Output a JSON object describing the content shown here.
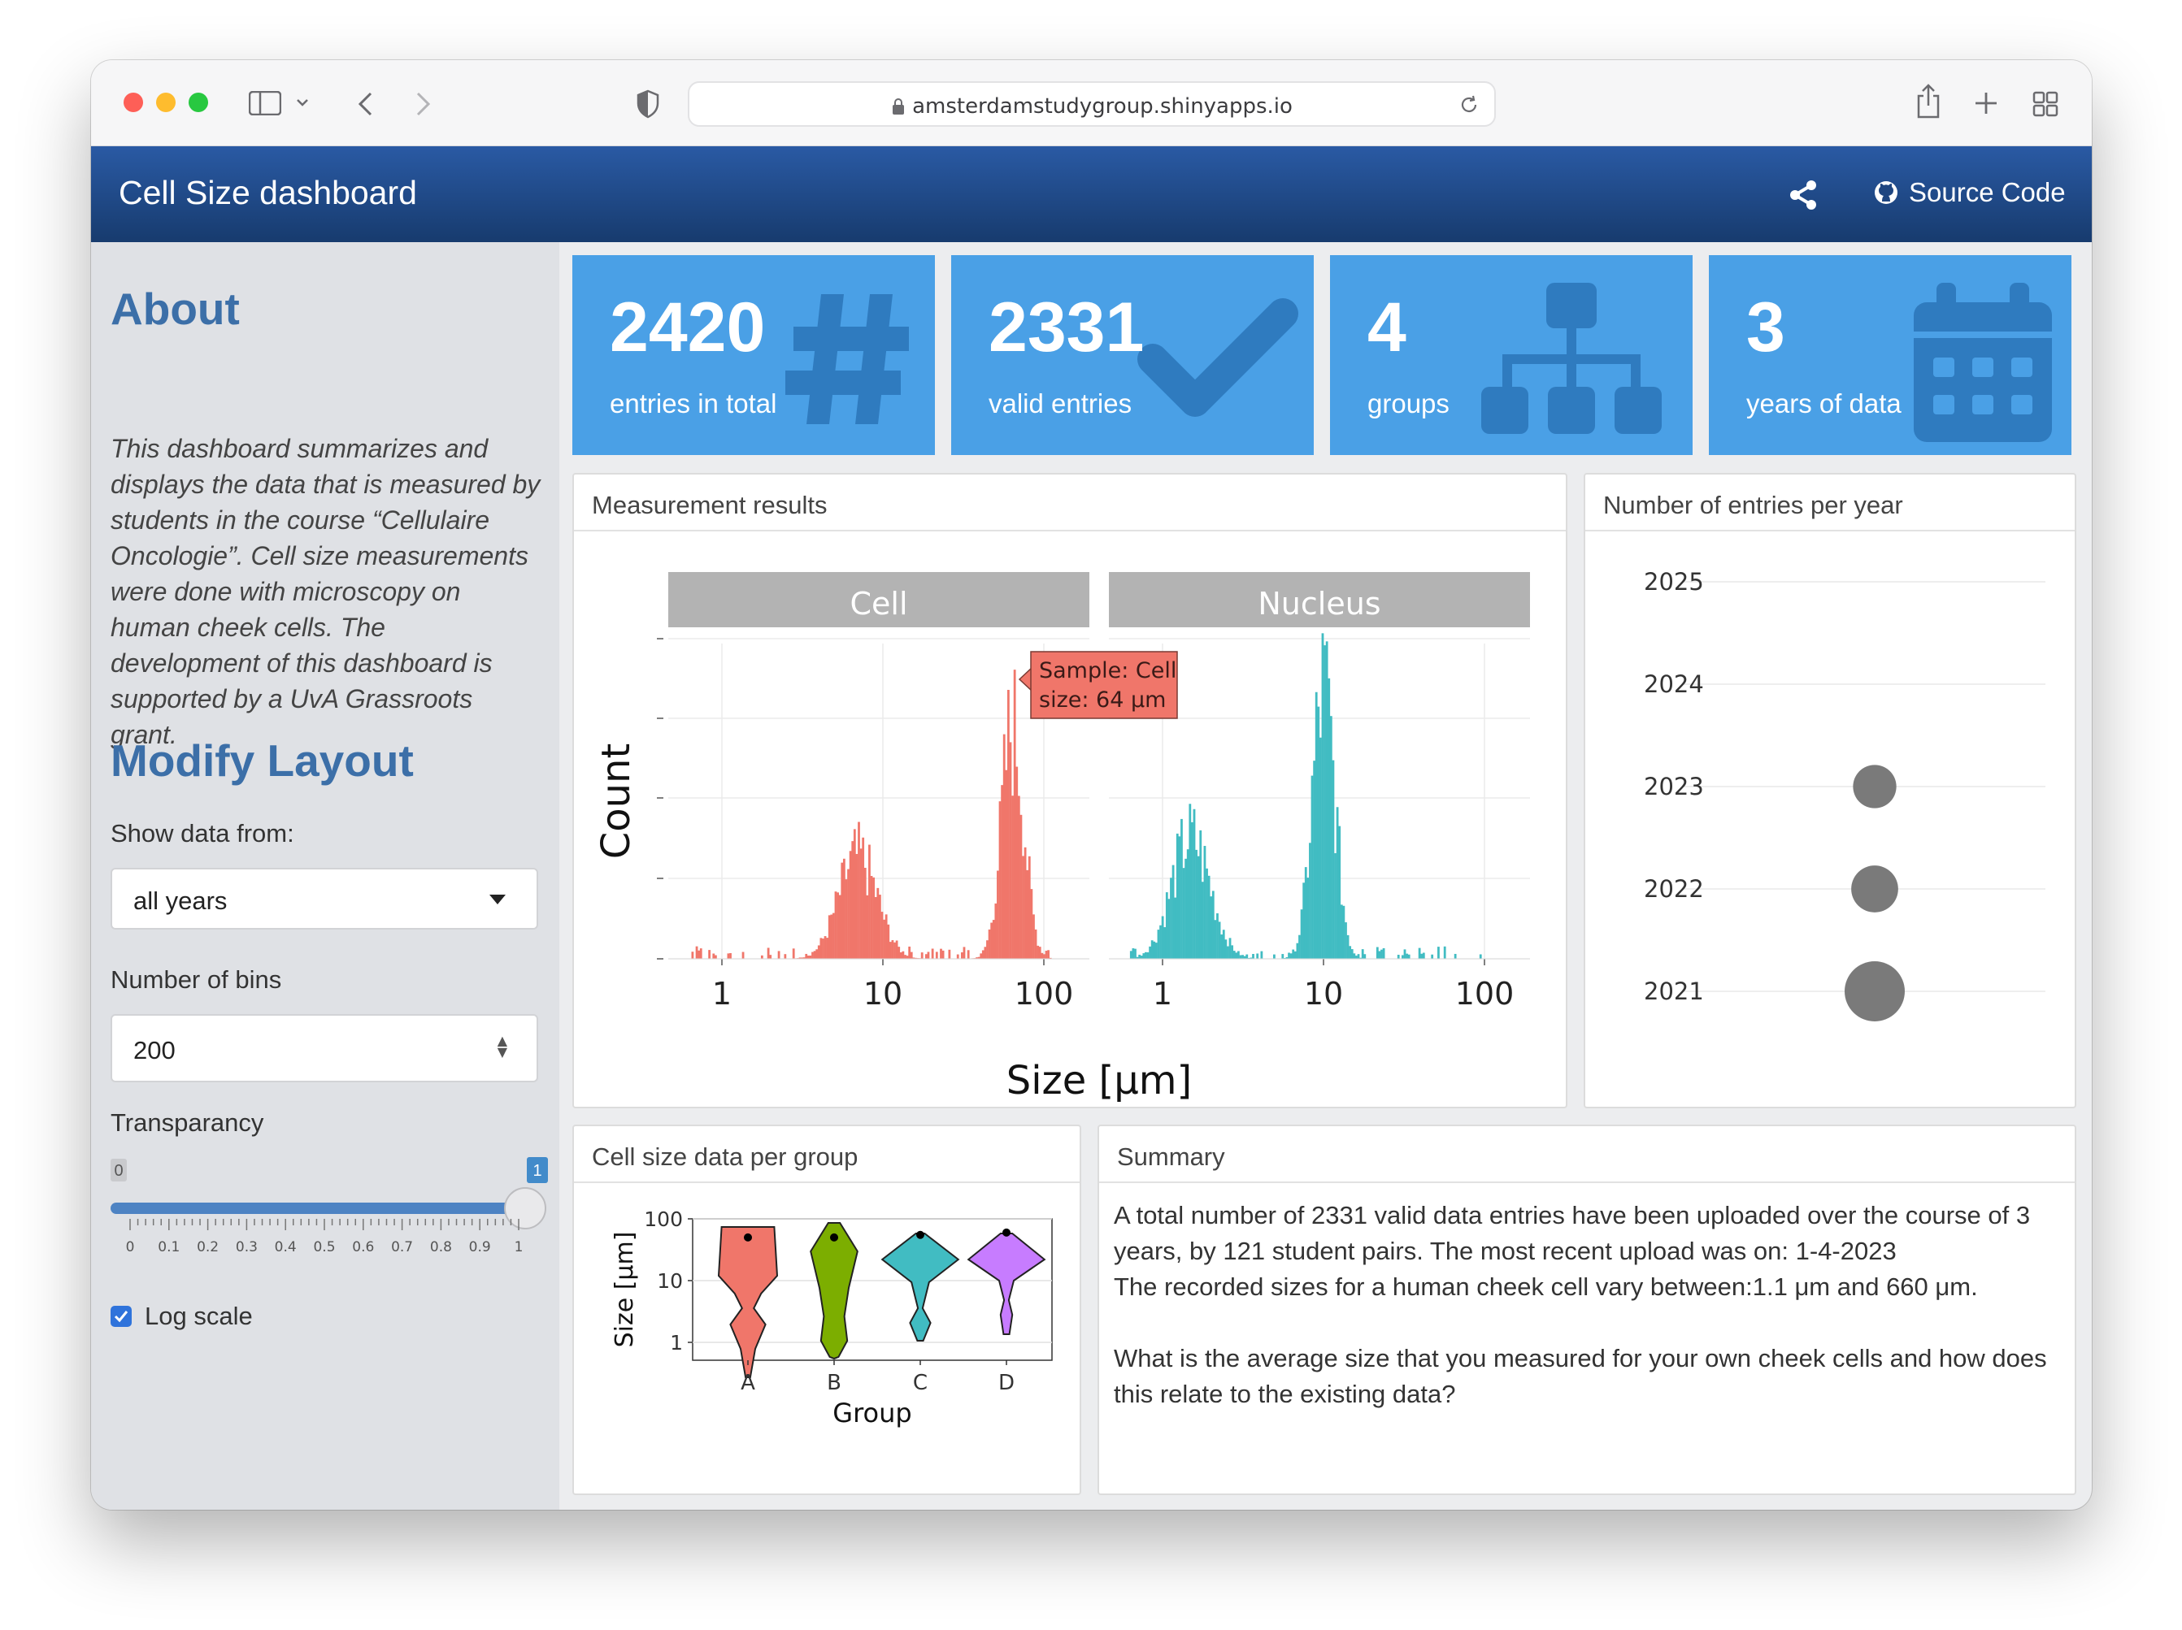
{
  "browser": {
    "url": "amsterdamstudygroup.shinyapps.io"
  },
  "navbar": {
    "title": "Cell Size dashboard",
    "source_code": "Source Code"
  },
  "sidebar": {
    "about_heading": "About",
    "about_text": "This dashboard summarizes and displays the data that is measured by students in the course “Cellulaire Oncologie”. Cell size measurements were done with microscopy on human cheek cells. The development of this dashboard is supported by a UvA Grassroots grant.",
    "layout_heading": "Modify Layout",
    "show_data_label": "Show data from:",
    "show_data_value": "all years",
    "bins_label": "Number of bins",
    "bins_value": "200",
    "transparancy_label": "Transparancy",
    "slider": {
      "min": "0",
      "max": "1",
      "value": "1",
      "ticks": [
        "0",
        "0.1",
        "0.2",
        "0.3",
        "0.4",
        "0.5",
        "0.6",
        "0.7",
        "0.8",
        "0.9",
        "1"
      ]
    },
    "log_scale_label": "Log scale",
    "log_scale_checked": true
  },
  "value_boxes": [
    {
      "value": "2420",
      "caption": "entries in total",
      "icon": "hashtag-icon"
    },
    {
      "value": "2331",
      "caption": "valid entries",
      "icon": "check-icon"
    },
    {
      "value": "4",
      "caption": "groups",
      "icon": "sitemap-icon"
    },
    {
      "value": "3",
      "caption": "years of data",
      "icon": "calendar-icon"
    }
  ],
  "cards": {
    "measurement_title": "Measurement results",
    "entries_title": "Number of entries per year",
    "group_title": "Cell size data per group",
    "summary_title": "Summary"
  },
  "summary": {
    "line1": "A total number of 2331 valid data entries have been uploaded over the course of 3 years, by 121 student pairs. The most recent upload was on: 1-4-2023",
    "line2": "The recorded sizes for a human cheek cell vary between:1.1 μm and 660 μm.",
    "question": "What is the average size that you measured for your own cheek cells and how does this relate to the existing data?"
  },
  "chart_data": [
    {
      "type": "bar",
      "facets": [
        "Cell",
        "Nucleus"
      ],
      "xlabel": "Size [μm]",
      "ylabel": "Count",
      "x_scale": "log",
      "x_ticks": [
        "1",
        "10",
        "100"
      ],
      "tooltip": {
        "line1": "Sample: Cell",
        "line2": "size: 64 μm"
      },
      "colors": {
        "Cell": "#f0766a",
        "Nucleus": "#41bcc2"
      },
      "series": [
        {
          "name": "Cell",
          "peaks": [
            {
              "x": 7,
              "height": 0.38
            },
            {
              "x": 64,
              "height": 0.86
            }
          ]
        },
        {
          "name": "Nucleus",
          "peaks": [
            {
              "x": 1.5,
              "height": 0.45
            },
            {
              "x": 10,
              "height": 1.0
            }
          ]
        }
      ]
    },
    {
      "type": "scatter",
      "y_categories": [
        "2025",
        "2024",
        "2023",
        "2022",
        "2021"
      ],
      "points": [
        {
          "year": "2023",
          "relative_size": 0.72
        },
        {
          "year": "2022",
          "relative_size": 0.78
        },
        {
          "year": "2021",
          "relative_size": 1.0
        }
      ],
      "point_color": "#7a7a7a"
    },
    {
      "type": "violin",
      "xlabel": "Group",
      "ylabel": "Size [μm]",
      "y_scale": "log",
      "y_ticks": [
        "1",
        "10",
        "100"
      ],
      "categories": [
        "A",
        "B",
        "C",
        "D"
      ],
      "colors": [
        "#f0766a",
        "#7cae00",
        "#41bcc2",
        "#c77cff"
      ],
      "medians": [
        50,
        50,
        55,
        60
      ]
    }
  ]
}
